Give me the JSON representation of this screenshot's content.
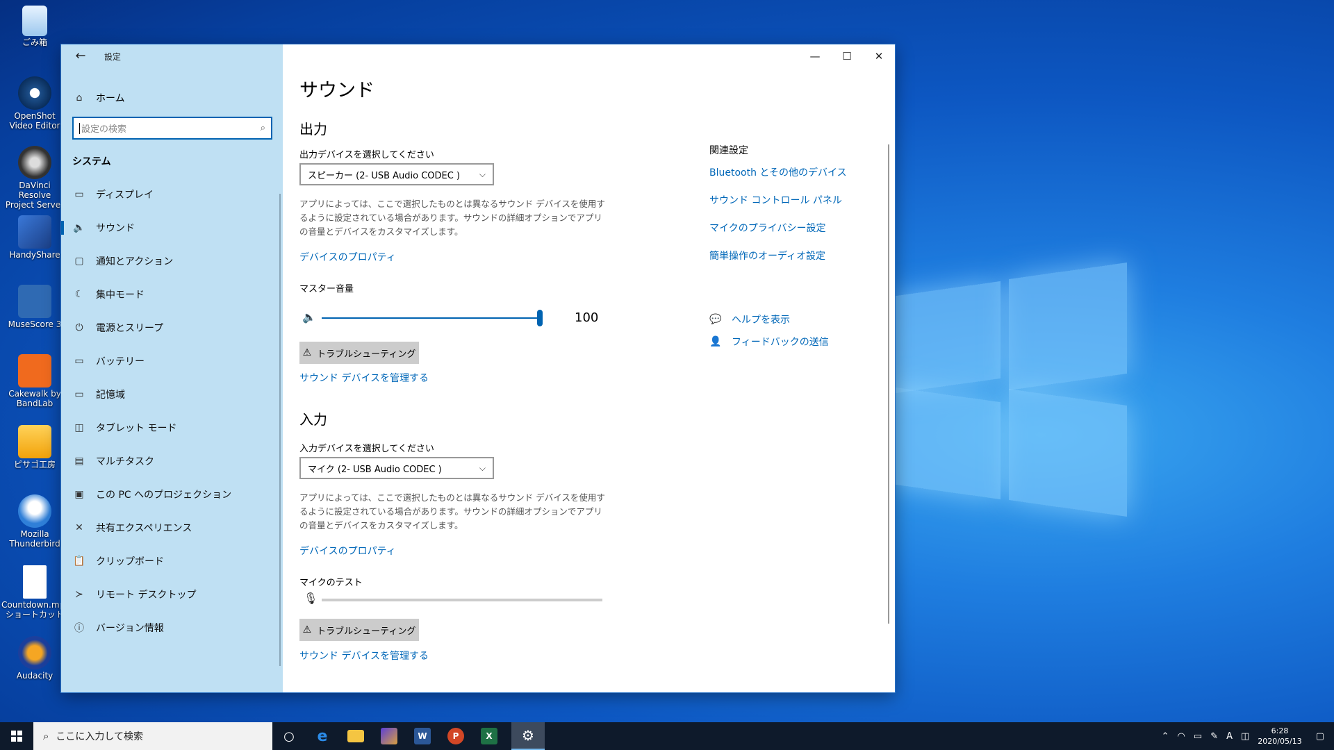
{
  "desktop": {
    "icons": [
      {
        "label": "ごみ箱",
        "icon": "recycle-bin-icon"
      },
      {
        "label": "OpenShot Video Editor",
        "icon": "openshot-icon"
      },
      {
        "label": "DaVinci Resolve Project Server",
        "icon": "davinci-icon"
      },
      {
        "label": "HandyShare",
        "icon": "handyshare-icon"
      },
      {
        "label": "MuseScore 3",
        "icon": "musescore-icon"
      },
      {
        "label": "Cakewalk by BandLab",
        "icon": "cakewalk-icon"
      },
      {
        "label": "ピサゴ工房",
        "icon": "app-icon"
      },
      {
        "label": "Mozilla Thunderbird",
        "icon": "thunderbird-icon"
      },
      {
        "label": "Countdown.mp4 ショートカット",
        "icon": "file-icon"
      },
      {
        "label": "Audacity",
        "icon": "audacity-icon"
      }
    ]
  },
  "window": {
    "title": "設定",
    "back_glyph": "←",
    "controls": {
      "minimize": "—",
      "maximize": "☐",
      "close": "✕"
    }
  },
  "sidebar": {
    "home": {
      "label": "ホーム",
      "icon": "home-icon"
    },
    "search_placeholder": "設定の検索",
    "section": "システム",
    "items": [
      {
        "label": "ディスプレイ",
        "icon": "display-icon",
        "glyph": "▭"
      },
      {
        "label": "サウンド",
        "icon": "speaker-icon",
        "glyph": "🔈",
        "active": true
      },
      {
        "label": "通知とアクション",
        "icon": "notification-icon",
        "glyph": "▢"
      },
      {
        "label": "集中モード",
        "icon": "moon-icon",
        "glyph": "☾"
      },
      {
        "label": "電源とスリープ",
        "icon": "power-icon",
        "glyph": "⏻"
      },
      {
        "label": "バッテリー",
        "icon": "battery-icon",
        "glyph": "▭"
      },
      {
        "label": "記憶域",
        "icon": "storage-icon",
        "glyph": "▭"
      },
      {
        "label": "タブレット モード",
        "icon": "tablet-icon",
        "glyph": "◫"
      },
      {
        "label": "マルチタスク",
        "icon": "multitask-icon",
        "glyph": "▤"
      },
      {
        "label": "この PC へのプロジェクション",
        "icon": "projection-icon",
        "glyph": "▣"
      },
      {
        "label": "共有エクスペリエンス",
        "icon": "shared-icon",
        "glyph": "✕"
      },
      {
        "label": "クリップボード",
        "icon": "clipboard-icon",
        "glyph": "📋"
      },
      {
        "label": "リモート デスクトップ",
        "icon": "remote-icon",
        "glyph": "≻"
      },
      {
        "label": "バージョン情報",
        "icon": "info-icon",
        "glyph": "ⓘ"
      }
    ]
  },
  "main": {
    "title": "サウンド",
    "output": {
      "heading": "出力",
      "select_label": "出力デバイスを選択してください",
      "device": "スピーカー (2- USB Audio CODEC )",
      "description": "アプリによっては、ここで選択したものとは異なるサウンド デバイスを使用するように設定されている場合があります。サウンドの詳細オプションでアプリの音量とデバイスをカスタマイズします。",
      "properties_link": "デバイスのプロパティ",
      "volume_label": "マスター音量",
      "volume_value": "100",
      "volume_fraction": 1.0,
      "troubleshoot": "トラブルシューティング",
      "manage_link": "サウンド デバイスを管理する"
    },
    "input": {
      "heading": "入力",
      "select_label": "入力デバイスを選択してください",
      "device": "マイク (2- USB Audio CODEC )",
      "description": "アプリによっては、ここで選択したものとは異なるサウンド デバイスを使用するように設定されている場合があります。サウンドの詳細オプションでアプリの音量とデバイスをカスタマイズします。",
      "properties_link": "デバイスのプロパティ",
      "mic_test_label": "マイクのテスト",
      "mic_level": 0,
      "troubleshoot": "トラブルシューティング",
      "manage_link": "サウンド デバイスを管理する"
    },
    "related": {
      "title": "関連設定",
      "links": [
        "Bluetooth とその他のデバイス",
        "サウンド コントロール パネル",
        "マイクのプライバシー設定",
        "簡単操作のオーディオ設定"
      ]
    },
    "help": {
      "get_help": "ヘルプを表示",
      "feedback": "フィードバックの送信"
    }
  },
  "taskbar": {
    "search_placeholder": "ここに入力して検索",
    "apps": [
      {
        "name": "cortana",
        "icon": "cortana-icon"
      },
      {
        "name": "edge",
        "icon": "edge-icon"
      },
      {
        "name": "file-explorer",
        "icon": "folder-icon"
      },
      {
        "name": "app",
        "icon": "app-icon"
      },
      {
        "name": "word",
        "icon": "word-icon",
        "letter": "W"
      },
      {
        "name": "powerpoint",
        "icon": "powerpoint-icon",
        "letter": "P"
      },
      {
        "name": "excel",
        "icon": "excel-icon",
        "letter": "X"
      },
      {
        "name": "settings",
        "icon": "gear-icon",
        "active": true
      }
    ],
    "tray": {
      "ime": "A",
      "time": "6:28",
      "date": "2020/05/13"
    }
  },
  "colors": {
    "accent": "#0063b1",
    "link": "#0067b8",
    "sidebar_bg": "#bfe0f3",
    "taskbar_bg": "#0e1a2b"
  }
}
